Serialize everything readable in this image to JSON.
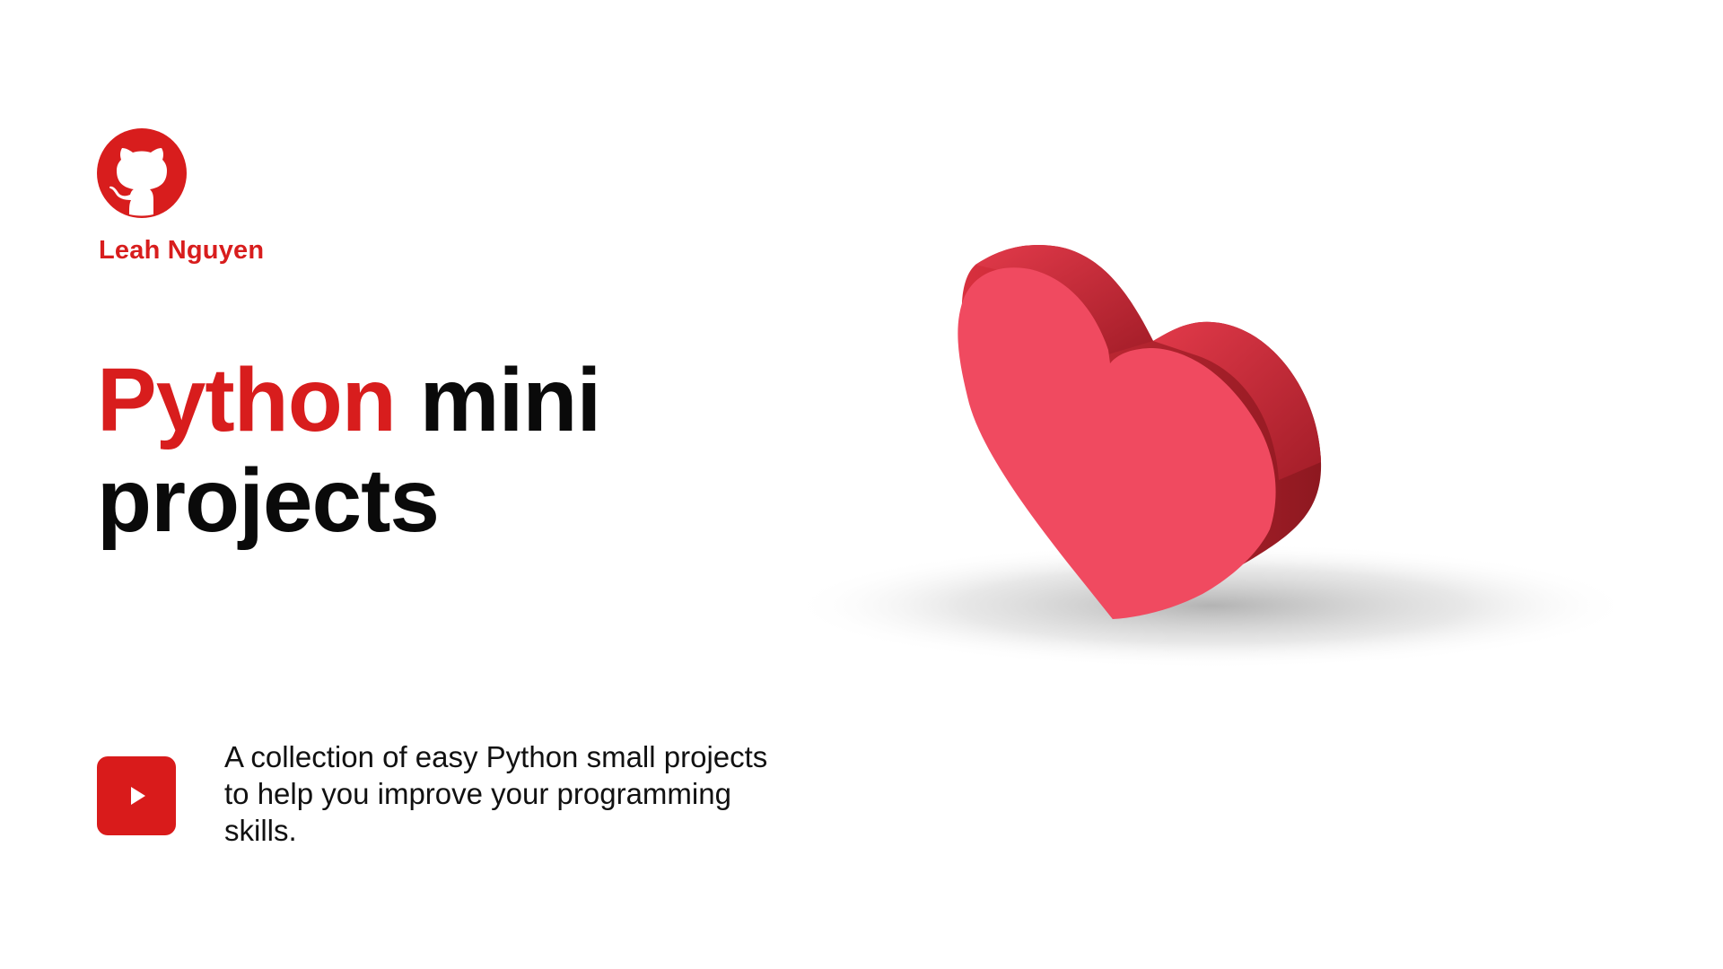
{
  "author": {
    "name": "Leah Nguyen",
    "icon": "github-icon"
  },
  "title": {
    "accent": "Python",
    "rest_line1": " mini",
    "rest_line2": "projects"
  },
  "description": {
    "icon": "youtube-play-icon",
    "text": "A collection of easy Python small projects to help you improve your programming skills."
  },
  "illustration": {
    "icon": "heart-icon"
  },
  "colors": {
    "brand_red": "#d81d1d",
    "heart_front": "#f04a60",
    "heart_side": "#b8222f",
    "text": "#0a0a0a"
  }
}
